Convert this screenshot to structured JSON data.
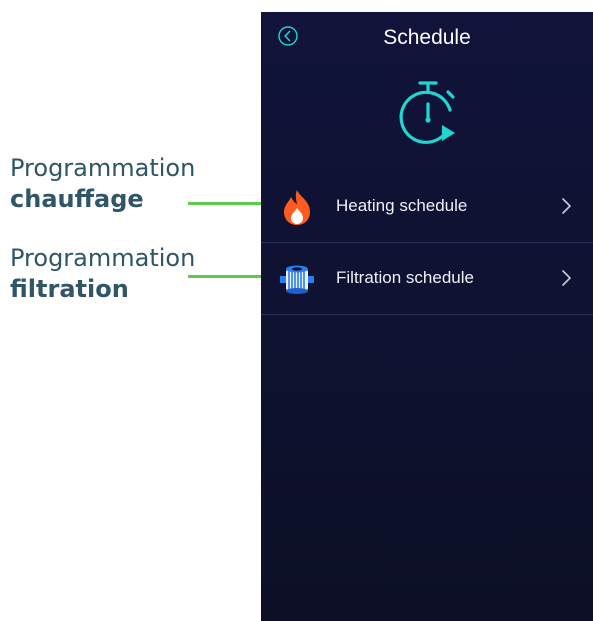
{
  "annotations": [
    {
      "line1": "Programmation",
      "line2": "chauffage"
    },
    {
      "line1": "Programmation",
      "line2": "filtration"
    }
  ],
  "colors": {
    "annotation_text": "#2f5566",
    "arrow": "#5ecb4a",
    "screen_bg": "#11133a",
    "accent_cyan": "#1fd6d0",
    "flame": "#ff5a1f",
    "filter_blue": "#2a7cf0"
  },
  "header": {
    "title": "Schedule",
    "back_icon": "circle-chevron-left-icon"
  },
  "main_icon": "stopwatch-play-icon",
  "menu": [
    {
      "label": "Heating schedule",
      "icon": "flame-icon",
      "chevron": "chevron-right-icon"
    },
    {
      "label": "Filtration schedule",
      "icon": "filter-cartridge-icon",
      "chevron": "chevron-right-icon"
    }
  ]
}
